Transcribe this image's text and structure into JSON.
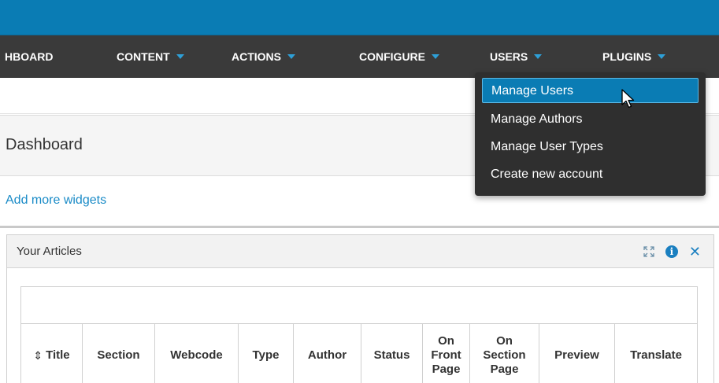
{
  "navbar": {
    "items": [
      {
        "label": "HBOARD",
        "caret": false
      },
      {
        "label": "CONTENT",
        "caret": true
      },
      {
        "label": "ACTIONS",
        "caret": true
      },
      {
        "label": "CONFIGURE",
        "caret": true
      },
      {
        "label": "USERS",
        "caret": true
      },
      {
        "label": "PLUGINS",
        "caret": true
      }
    ]
  },
  "users_menu": {
    "items": [
      {
        "label": "Manage Users",
        "highlighted": true
      },
      {
        "label": "Manage Authors",
        "highlighted": false
      },
      {
        "label": "Manage User Types",
        "highlighted": false
      },
      {
        "label": "Create new account",
        "highlighted": false
      }
    ]
  },
  "page": {
    "title": "Dashboard",
    "add_widgets": "Add more widgets"
  },
  "panel": {
    "title": "Your Articles",
    "icons": [
      "expand-icon",
      "info-icon",
      "close-icon"
    ]
  },
  "table": {
    "columns": [
      {
        "label": "Title",
        "sortable": true
      },
      {
        "label": "Section"
      },
      {
        "label": "Webcode"
      },
      {
        "label": "Type"
      },
      {
        "label": "Author"
      },
      {
        "label": "Status"
      },
      {
        "label": "On Front Page"
      },
      {
        "label": "On Section Page"
      },
      {
        "label": "Preview"
      },
      {
        "label": "Translate"
      }
    ]
  },
  "colors": {
    "brand_blue": "#0a7cb4",
    "navbar_bg": "#3a3a3a",
    "link": "#1a8bc7",
    "caret": "#2e9fd6"
  }
}
